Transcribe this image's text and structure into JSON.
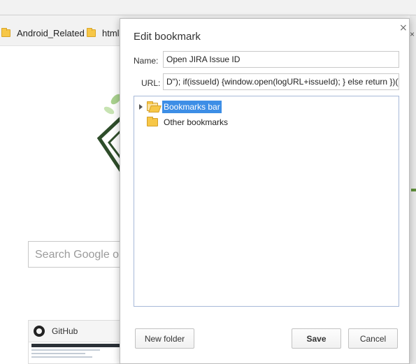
{
  "background": {
    "bookmarks_bar": {
      "items": [
        {
          "label": "Android_Related",
          "icon": "folder-icon"
        },
        {
          "label": "html",
          "icon": "folder-icon"
        }
      ]
    },
    "search_placeholder": "Search Google or type URL",
    "tiles": [
      {
        "title": "GitHub",
        "icon": "github-icon"
      }
    ]
  },
  "dialog": {
    "title": "Edit bookmark",
    "close_icon": "close-icon",
    "close_glyph": "×",
    "name_label": "Name:",
    "name_value": "Open JIRA Issue ID",
    "url_label": "URL:",
    "url_value": "D\"); if(issueId) {window.open(logURL+issueId); } else return })();",
    "tree": [
      {
        "label": "Bookmarks bar",
        "selected": true,
        "expandable": true,
        "icon": "folder-open-icon"
      },
      {
        "label": "Other bookmarks",
        "selected": false,
        "expandable": false,
        "icon": "folder-icon"
      }
    ],
    "buttons": {
      "new_folder": "New folder",
      "save": "Save",
      "cancel": "Cancel"
    }
  },
  "colors": {
    "selection": "#3d8ee6",
    "tree_border": "#a7b9d8",
    "folder": "#f7c747"
  }
}
